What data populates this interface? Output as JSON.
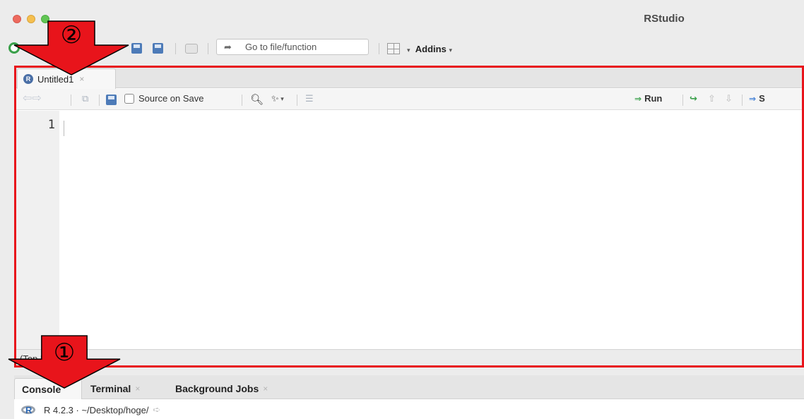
{
  "window": {
    "title": "RStudio"
  },
  "toolbar": {
    "goto_placeholder": "Go to file/function",
    "addins_label": "Addins"
  },
  "editor": {
    "tab_label": "Untitled1",
    "source_on_save_label": "Source on Save",
    "run_label": "Run",
    "source_label_partial": "S",
    "line_numbers": [
      "1"
    ],
    "scope_label": "(Top Level)"
  },
  "console": {
    "tabs": [
      "Console",
      "Terminal",
      "Background Jobs"
    ],
    "path": "R 4.2.3 · ~/Desktop/hoge/"
  },
  "annotations": {
    "arrow_1_label": "①",
    "arrow_2_label": "②",
    "arrow_color": "#e8141b",
    "frame_color": "#e8141b"
  }
}
